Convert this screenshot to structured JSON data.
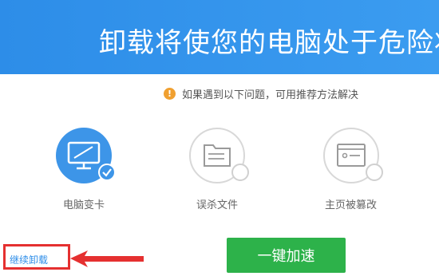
{
  "header": {
    "title": "卸载将使您的电脑处于危险状态"
  },
  "notice": {
    "icon": "info-icon",
    "text": "如果遇到以下问题，可用推荐方法解决"
  },
  "issues": [
    {
      "label": "电脑变卡",
      "icon": "monitor-icon",
      "state": "selected"
    },
    {
      "label": "误杀文件",
      "icon": "folder-icon",
      "state": "unselected"
    },
    {
      "label": "主页被篡改",
      "icon": "browser-window-icon",
      "state": "unselected"
    }
  ],
  "footer": {
    "continue_label": "继续卸载",
    "speed_button_label": "一键加速"
  },
  "colors": {
    "header": "#2d8de8",
    "accent_blue": "#3d95e8",
    "button_green": "#2db24a",
    "annotation_red": "#e53030",
    "info_orange": "#f0a030"
  }
}
